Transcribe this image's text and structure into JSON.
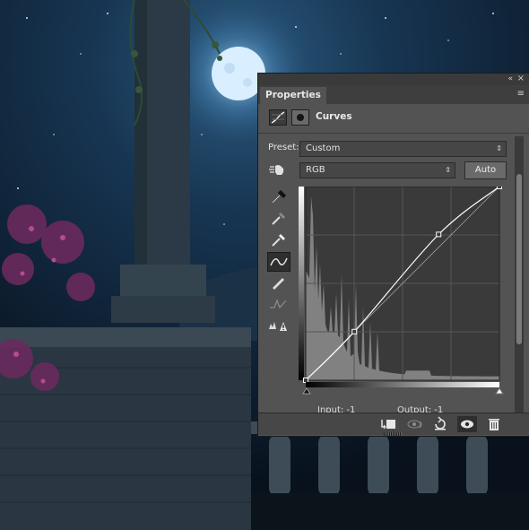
{
  "panel": {
    "tab_label": "Properties",
    "header_title": "Curves",
    "preset_label": "Preset:",
    "preset_value": "Custom",
    "channel_value": "RGB",
    "auto_label": "Auto",
    "input_label": "Input: -1",
    "output_label": "Output: -1"
  },
  "colors": {
    "panel_bg": "#535353",
    "graph_bg": "#3a3a3a",
    "histogram": "#8a8a8a",
    "curve": "#ffffff"
  },
  "icons": {
    "collapse": "«",
    "close": "×",
    "panel_menu": "≡",
    "select_arrow": "⇕"
  },
  "curve_points": [
    [
      0,
      0
    ],
    [
      64,
      64
    ],
    [
      175,
      192
    ],
    [
      255,
      255
    ]
  ]
}
